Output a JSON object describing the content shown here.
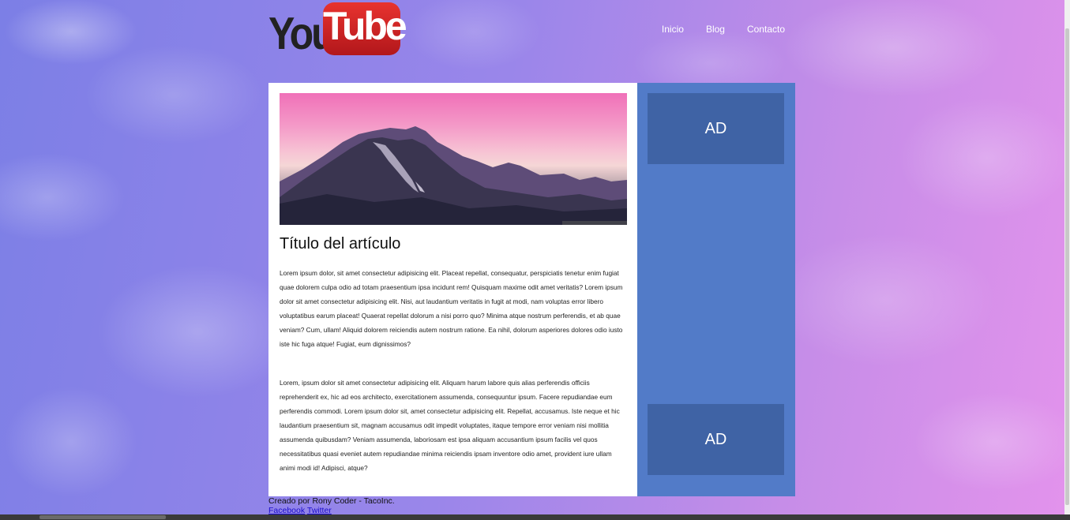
{
  "header": {
    "logo": {
      "you": "You",
      "tube": "Tube"
    },
    "nav": [
      "Inicio",
      "Blog",
      "Contacto"
    ]
  },
  "article": {
    "title": "Título del artículo",
    "paragraphs": [
      "Lorem ipsum dolor, sit amet consectetur adipisicing elit. Placeat repellat, consequatur, perspiciatis tenetur enim fugiat quae dolorem culpa odio ad totam praesentium ipsa incidunt rem! Quisquam maxime odit amet veritatis? Lorem ipsum dolor sit amet consectetur adipisicing elit. Nisi, aut laudantium veritatis in fugit at modi, nam voluptas error libero voluptatibus earum placeat! Quaerat repellat dolorum a nisi porro quo? Minima atque nostrum perferendis, et ab quae veniam? Cum, ullam! Aliquid dolorem reiciendis autem nostrum ratione. Ea nihil, dolorum asperiores dolores odio iusto iste hic fuga atque! Fugiat, eum dignissimos?",
      "Lorem, ipsum dolor sit amet consectetur adipisicing elit. Aliquam harum labore quis alias perferendis officiis reprehenderit ex, hic ad eos architecto, exercitationem assumenda, consequuntur ipsum. Facere repudiandae eum perferendis commodi. Lorem ipsum dolor sit, amet consectetur adipisicing elit. Repellat, accusamus. Iste neque et hic laudantium praesentium sit, magnam accusamus odit impedit voluptates, itaque tempore error veniam nisi mollitia assumenda quibusdam? Veniam assumenda, laboriosam est ipsa aliquam accusantium ipsum facilis vel quos necessitatibus quasi eveniet autem repudiandae minima reiciendis ipsam inventore odio amet, provident iure ullam animi modi id! Adipisci, atque?"
    ]
  },
  "sidebar": {
    "ads": [
      "AD",
      "AD"
    ]
  },
  "footer": {
    "credit": "Creado por Rony Coder - TacoInc.",
    "links": [
      "Facebook",
      "Twitter"
    ]
  }
}
